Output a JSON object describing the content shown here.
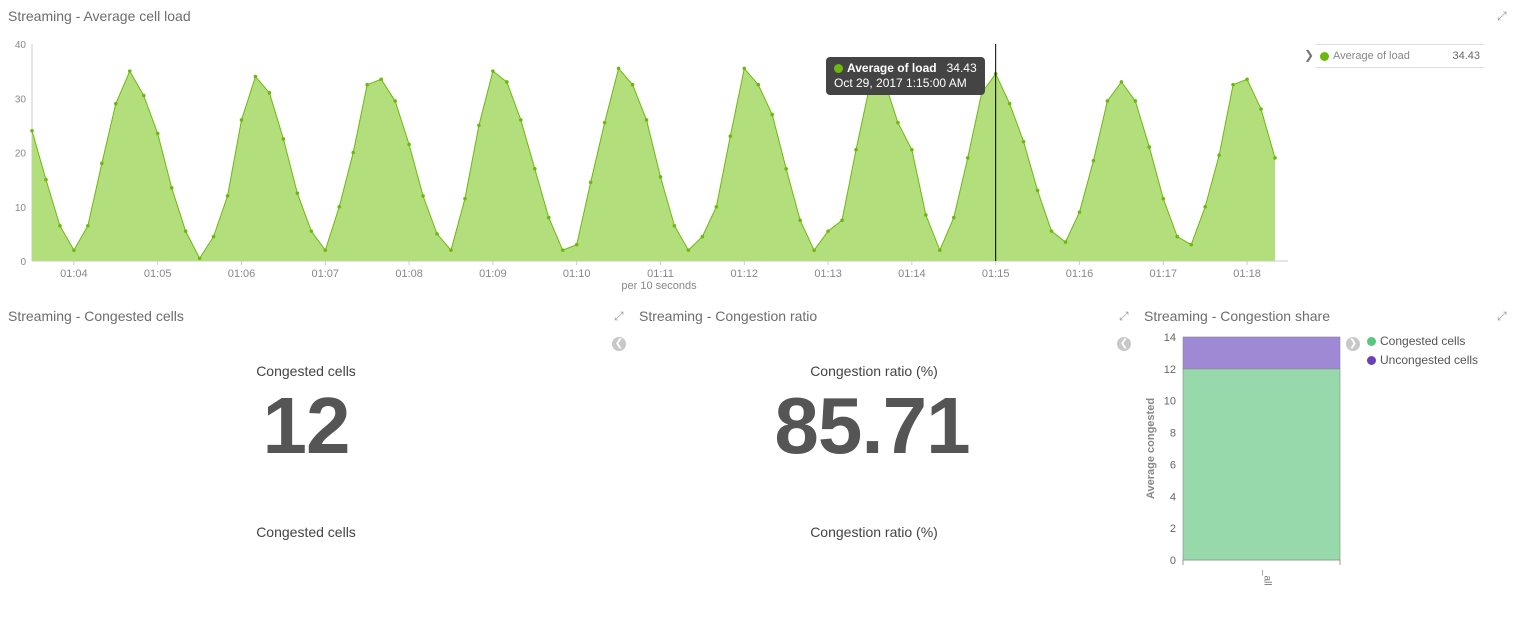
{
  "top_panel": {
    "title": "Streaming - Average cell load",
    "legend": {
      "label": "Average of load",
      "value": "34.43",
      "color": "#6eb80e"
    },
    "tooltip": {
      "series": "Average of load",
      "value": "34.43",
      "date": "Oct 29, 2017 1:15:00 AM"
    },
    "x_unit_label": "per 10 seconds"
  },
  "chart_data": [
    {
      "type": "area",
      "title": "Streaming - Average cell load",
      "xlabel": "per 10 seconds",
      "ylabel": "",
      "ylim": [
        0,
        40
      ],
      "yticks": [
        0,
        10,
        20,
        30,
        40
      ],
      "x_tick_labels": [
        "01:04",
        "01:05",
        "01:06",
        "01:07",
        "01:08",
        "01:09",
        "01:10",
        "01:11",
        "01:12",
        "01:13",
        "01:14",
        "01:15",
        "01:16",
        "01:17",
        "01:18"
      ],
      "series": [
        {
          "name": "Average of load",
          "color": "#6eb80e",
          "fill": "#b3de7c",
          "x_start": "01:03:30",
          "x_step_seconds": 10,
          "values": [
            24,
            15,
            6.5,
            2,
            6.5,
            18,
            29,
            35,
            30.5,
            23.5,
            13.5,
            5.5,
            0.5,
            4.5,
            12,
            26,
            34,
            31,
            22.5,
            12.5,
            5.5,
            2,
            10,
            20,
            32.5,
            33.5,
            29.5,
            21.5,
            12,
            5,
            2,
            11.5,
            25,
            35,
            33,
            26,
            17,
            8,
            2,
            3,
            14.5,
            25.5,
            35.5,
            32.5,
            26,
            15.5,
            6.5,
            2,
            4.5,
            10,
            23,
            35.5,
            32.5,
            27,
            17,
            7.5,
            2,
            5.5,
            7.5,
            20.5,
            32.5,
            33.5,
            25.5,
            20.5,
            8.5,
            2,
            8,
            19,
            31,
            34.5,
            29,
            22,
            13,
            5.5,
            3.5,
            9,
            18.5,
            29.5,
            33,
            29.5,
            21,
            11.5,
            4.5,
            3,
            10,
            19.5,
            32.5,
            33.5,
            28,
            19
          ]
        }
      ],
      "grid": false,
      "legend_position": "right"
    },
    {
      "type": "bar",
      "title": "Streaming - Congestion share",
      "categories": [
        "_all"
      ],
      "ylabel": "Average congested",
      "ylim": [
        0,
        14
      ],
      "yticks": [
        0,
        2,
        4,
        6,
        8,
        10,
        12,
        14
      ],
      "stacked": true,
      "series": [
        {
          "name": "Congested cells",
          "values": [
            12
          ],
          "color": "#98d9ab"
        },
        {
          "name": "Uncongested cells",
          "values": [
            2
          ],
          "color": "#a089d4"
        }
      ],
      "legend_position": "right"
    }
  ],
  "congested_panel": {
    "title": "Streaming - Congested cells",
    "label_top": "Congested cells",
    "value": "12",
    "label_bottom": "Congested cells"
  },
  "ratio_panel": {
    "title": "Streaming - Congestion ratio",
    "label_top": "Congestion ratio (%)",
    "value": "85.71",
    "label_bottom": "Congestion ratio (%)"
  },
  "share_panel": {
    "title": "Streaming - Congestion share",
    "legend": [
      {
        "label": "Congested cells",
        "color": "#59c77e"
      },
      {
        "label": "Uncongested cells",
        "color": "#6a3fb8"
      }
    ]
  },
  "icons": {
    "expand": "expand-icon",
    "nav_left": "chevron-left-icon",
    "nav_right": "chevron-right-icon",
    "legend_toggle": "chevron-right-icon"
  }
}
